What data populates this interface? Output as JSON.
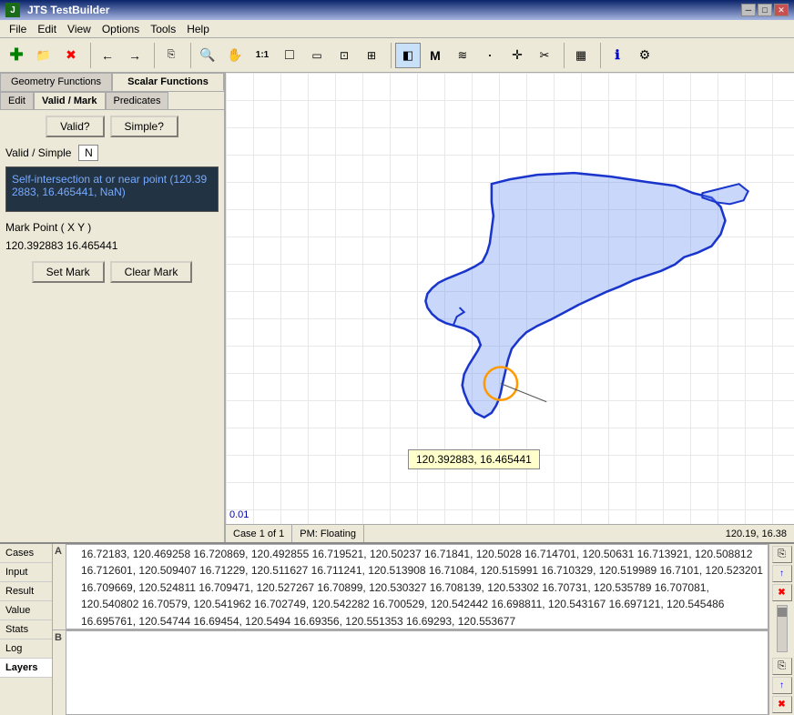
{
  "titlebar": {
    "title": "JTS TestBuilder",
    "controls": [
      "minimize",
      "maximize",
      "close"
    ]
  },
  "menubar": {
    "items": [
      "File",
      "Edit",
      "View",
      "Options",
      "Tools",
      "Help"
    ]
  },
  "tabs": {
    "main": [
      "Geometry Functions",
      "Scalar Functions"
    ],
    "sub": [
      "Edit",
      "Valid / Mark",
      "Predicates"
    ]
  },
  "left_panel": {
    "valid_label": "Valid?",
    "simple_label": "Simple?",
    "valid_simple_text": "Valid / Simple",
    "valid_simple_value": "N",
    "info_text": "Self-intersection at or near point (120.39\n2883, 16.465441, NaN)",
    "mark_point_label": "Mark Point ( X Y )",
    "mark_point_value": "120.392883  16.465441",
    "set_mark": "Set Mark",
    "clear_mark": "Clear Mark"
  },
  "map": {
    "scale": "0.01",
    "tooltip": "120.392883, 16.465441"
  },
  "statusbar": {
    "case_label": "Case 1 of 1",
    "pm_label": "PM: Floating",
    "coords": "120.19, 16.38"
  },
  "bottom": {
    "side_tabs": [
      "Cases",
      "Input",
      "Result",
      "Value",
      "Stats",
      "Log",
      "Layers"
    ],
    "panel_a_label": "A",
    "panel_b_label": "B",
    "text_a": "16.72183, 120.469258 16.720869, 120.492855 16.719521, 120.50237 16.71841, 120.5028 16.714701, 120.50631 16.713921, 120.508812 16.712601, 120.509407 16.71229, 120.511627 16.711241, 120.513908 16.71084, 120.515991 16.710329, 120.519989 16.7101, 120.523201 16.709669, 120.524811 16.709471, 120.527267 16.70899, 120.530327 16.708139, 120.53302 16.70731, 120.535789 16.707081, 120.540802 16.70579, 120.541962 16.702749, 120.542282 16.700529, 120.542442 16.698811, 120.543167 16.697121, 120.545486 16.695761, 120.54744 16.69454, 120.5494 16.69356, 120.551353 16.69293, 120.553677",
    "text_b": ""
  },
  "toolbar_buttons": [
    {
      "name": "new-geometry",
      "icon": "✚",
      "color": "green"
    },
    {
      "name": "open",
      "icon": "📂",
      "color": "default"
    },
    {
      "name": "close",
      "icon": "✖",
      "color": "red"
    },
    {
      "name": "back",
      "icon": "←",
      "color": "default"
    },
    {
      "name": "forward",
      "icon": "→",
      "color": "default"
    },
    {
      "name": "copy",
      "icon": "⎘",
      "color": "default"
    },
    {
      "name": "zoom-in",
      "icon": "🔍",
      "color": "default"
    },
    {
      "name": "pan",
      "icon": "✋",
      "color": "default"
    },
    {
      "name": "zoom-100",
      "icon": "1:1",
      "color": "default"
    },
    {
      "name": "zoom-box",
      "icon": "□",
      "color": "default"
    },
    {
      "name": "zoom-rect",
      "icon": "▭",
      "color": "default"
    },
    {
      "name": "zoom-fit",
      "icon": "⊡",
      "color": "default"
    },
    {
      "name": "zoom-full",
      "icon": "⊞",
      "color": "default"
    },
    {
      "name": "select-geom",
      "icon": "◧",
      "color": "default"
    },
    {
      "name": "select-m",
      "icon": "Μ",
      "color": "default"
    },
    {
      "name": "draw-poly",
      "icon": "≈",
      "color": "default"
    },
    {
      "name": "dot",
      "icon": "•",
      "color": "default"
    },
    {
      "name": "move",
      "icon": "✛",
      "color": "default"
    },
    {
      "name": "scissors",
      "icon": "✂",
      "color": "default"
    },
    {
      "name": "grid",
      "icon": "▦",
      "color": "default"
    },
    {
      "name": "info",
      "icon": "ℹ",
      "color": "default"
    },
    {
      "name": "settings",
      "icon": "⚙",
      "color": "default"
    }
  ]
}
